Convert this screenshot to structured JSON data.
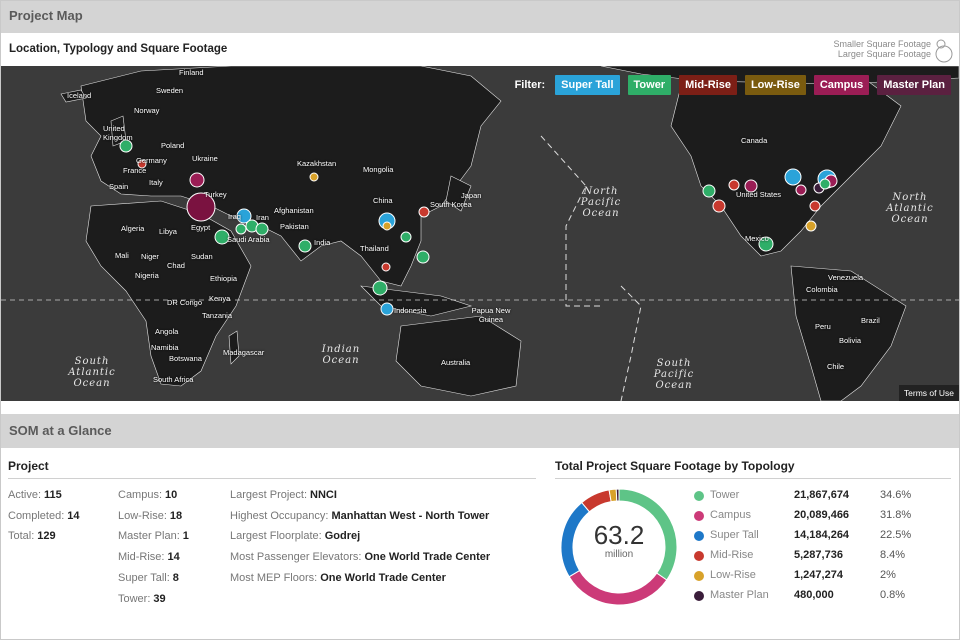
{
  "header": {
    "title": "Project Map"
  },
  "map": {
    "subtitle": "Location, Typology and Square Footage",
    "size_legend": {
      "small": "Smaller Square Footage",
      "large": "Larger Square Footage"
    },
    "filter_label": "Filter:",
    "filters": [
      {
        "label": "Super Tall",
        "color": "#2aa3d9"
      },
      {
        "label": "Tower",
        "color": "#2fae68"
      },
      {
        "label": "Mid-Rise",
        "color": "#7c1f16"
      },
      {
        "label": "Low-Rise",
        "color": "#7a5b0f"
      },
      {
        "label": "Campus",
        "color": "#9b1d55"
      },
      {
        "label": "Master Plan",
        "color": "#5b2040"
      }
    ],
    "country_labels": [
      "Finland",
      "Iceland",
      "Sweden",
      "Norway",
      "United Kingdom",
      "Poland",
      "Germany",
      "Ukraine",
      "France",
      "Italy",
      "Spain",
      "Kazakhstan",
      "Mongolia",
      "Turkey",
      "China",
      "Japan",
      "South Korea",
      "Iraq",
      "Iran",
      "Afghanistan",
      "Algeria",
      "Libya",
      "Egypt",
      "Saudi Arabia",
      "Pakistan",
      "India",
      "Thailand",
      "Mali",
      "Niger",
      "Chad",
      "Sudan",
      "Nigeria",
      "Ethiopia",
      "Indonesia",
      "Papua New Guinea",
      "DR Congo",
      "Kenya",
      "Tanzania",
      "Angola",
      "Namibia",
      "Botswana",
      "Madagascar",
      "South Africa",
      "Australia",
      "Canada",
      "United States",
      "Mexico",
      "Venezuela",
      "Colombia",
      "Peru",
      "Brazil",
      "Bolivia",
      "Chile"
    ],
    "oceans": {
      "north_pacific": "North Pacific Ocean",
      "north_atlantic": "North Atlantic Ocean",
      "south_atlantic": "South Atlantic Ocean",
      "indian": "Indian Ocean",
      "south_pacific": "South Pacific Ocean"
    },
    "terms": "Terms of Use"
  },
  "glance": {
    "title": "SOM at a Glance",
    "project_title": "Project",
    "counts": {
      "active_label": "Active:",
      "active": "115",
      "completed_label": "Completed:",
      "completed": "14",
      "total_label": "Total:",
      "total": "129"
    },
    "types": {
      "campus_label": "Campus:",
      "campus": "10",
      "lowrise_label": "Low-Rise:",
      "lowrise": "18",
      "masterplan_label": "Master Plan:",
      "masterplan": "1",
      "midrise_label": "Mid-Rise:",
      "midrise": "14",
      "supertall_label": "Super Tall:",
      "supertall": "8",
      "tower_label": "Tower:",
      "tower": "39"
    },
    "records": {
      "largest_project_label": "Largest Project:",
      "largest_project": "NNCI",
      "highest_occupancy_label": "Highest Occupancy:",
      "highest_occupancy": "Manhattan West - North Tower",
      "largest_floorplate_label": "Largest Floorplate:",
      "largest_floorplate": "Godrej",
      "elevators_label": "Most Passenger Elevators:",
      "elevators": "One World Trade Center",
      "mep_label": "Most MEP Floors:",
      "mep": "One World Trade Center"
    },
    "sqft_title": "Total Project Square Footage by Topology",
    "donut_total": "63.2",
    "donut_unit": "million"
  },
  "chart_data": {
    "type": "pie",
    "title": "Total Project Square Footage by Topology",
    "categories": [
      "Tower",
      "Campus",
      "Super Tall",
      "Mid-Rise",
      "Low-Rise",
      "Master Plan"
    ],
    "values": [
      21867674,
      20089466,
      14184264,
      5287736,
      1247274,
      480000
    ],
    "display_values": [
      "21,867,674",
      "20,089,466",
      "14,184,264",
      "5,287,736",
      "1,247,274",
      "480,000"
    ],
    "percents": [
      "34.6%",
      "31.8%",
      "22.5%",
      "8.4%",
      "2%",
      "0.8%"
    ],
    "colors": [
      "#5ec487",
      "#cc3a78",
      "#1e78c8",
      "#c8392e",
      "#d8a22a",
      "#3a1d3a"
    ],
    "center_text": "63.2 million"
  }
}
